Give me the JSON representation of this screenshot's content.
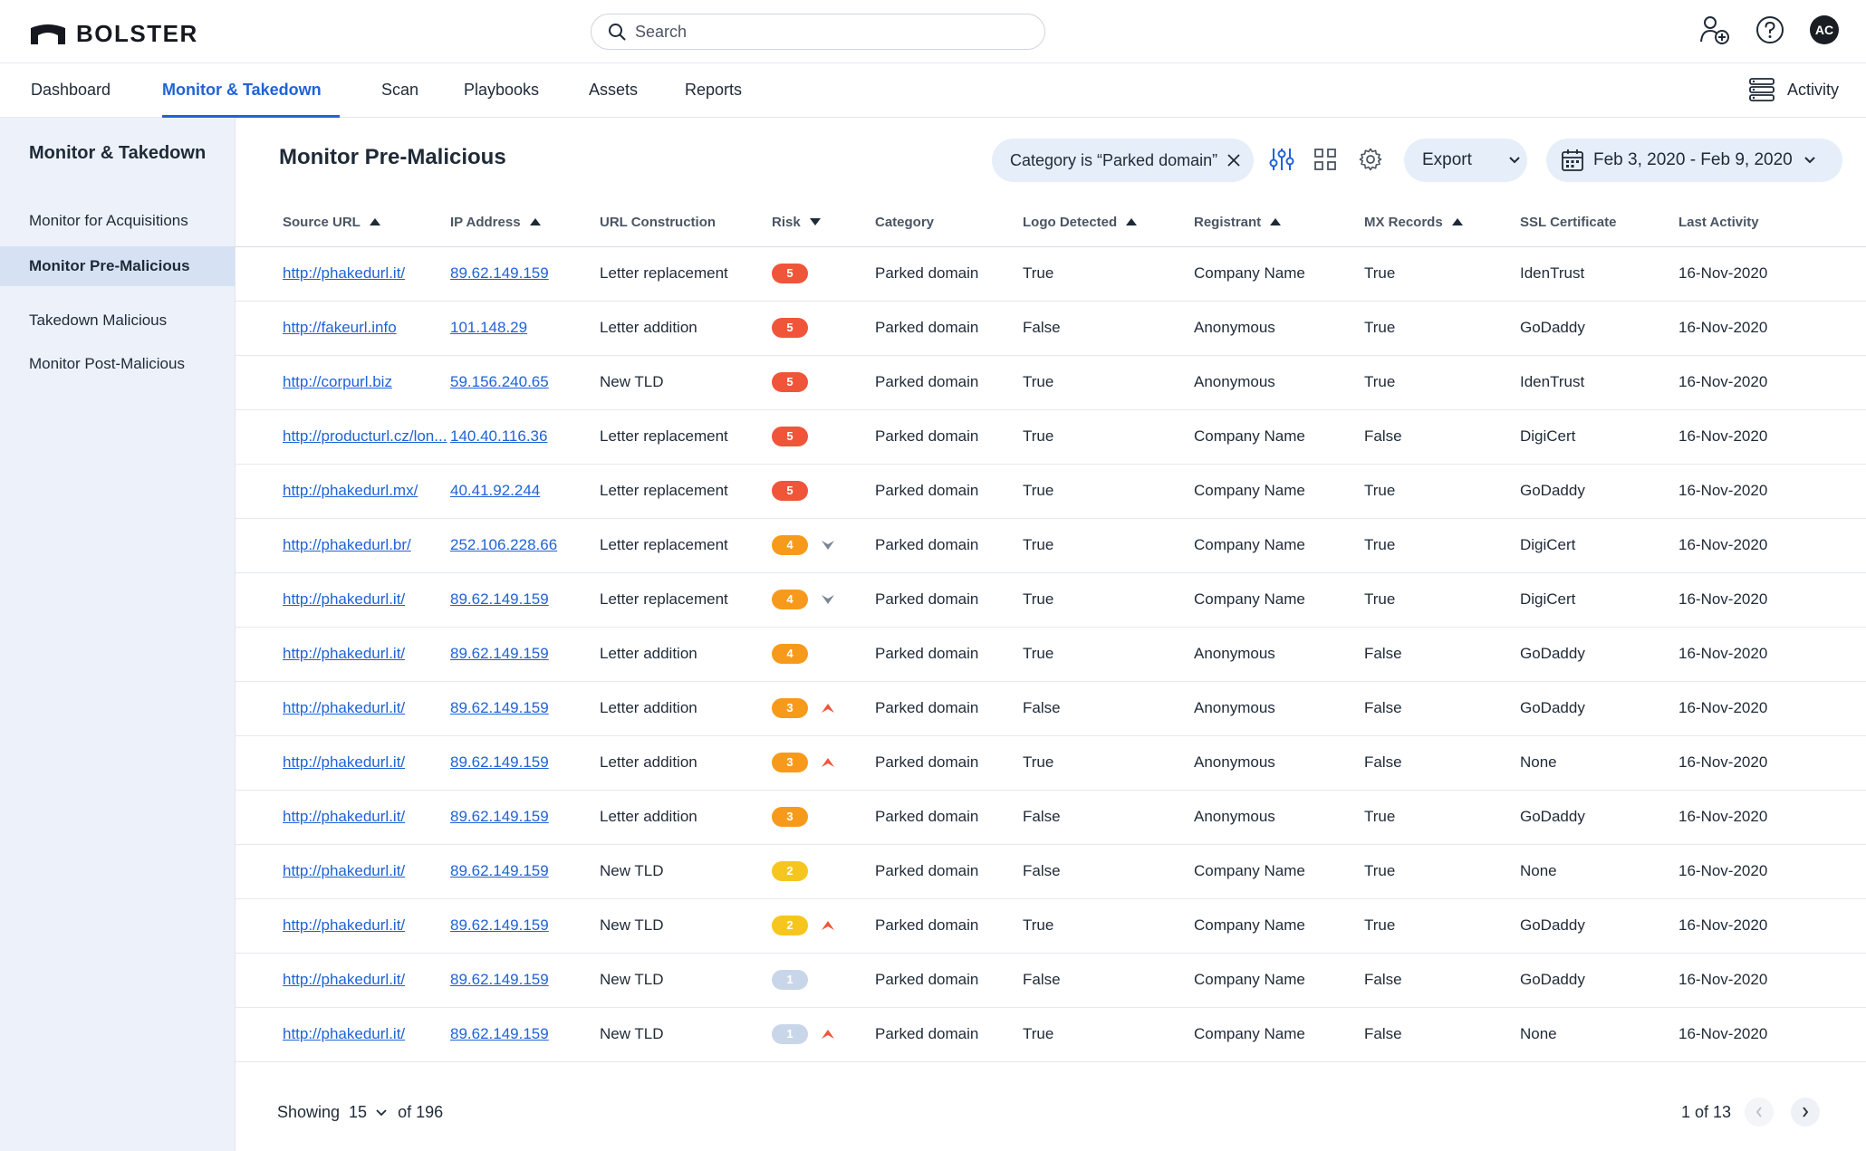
{
  "brand": {
    "name": "BOLSTER"
  },
  "search": {
    "placeholder": "Search"
  },
  "user": {
    "initials": "AC"
  },
  "nav": {
    "tabs": [
      "Dashboard",
      "Monitor & Takedown",
      "Scan",
      "Playbooks",
      "Assets",
      "Reports"
    ],
    "active_tab": "Monitor & Takedown",
    "activity_label": "Activity"
  },
  "sidebar": {
    "title": "Monitor & Takedown",
    "items": [
      "Monitor for Acquisitions",
      "Monitor Pre-Malicious",
      "Takedown Malicious",
      "Monitor Post-Malicious"
    ],
    "active_item": "Monitor Pre-Malicious"
  },
  "page": {
    "title": "Monitor Pre-Malicious",
    "filter_chip": "Category is “Parked domain”",
    "export_label": "Export",
    "date_range": "Feb 3, 2020 - Feb 9, 2020"
  },
  "table": {
    "columns": [
      "Source URL",
      "IP Address",
      "URL Construction",
      "Risk",
      "Category",
      "Logo Detected",
      "Registrant",
      "MX Records",
      "SSL Certificate",
      "Last Activity"
    ],
    "risk_colors": {
      "5": "#f0553a",
      "4": "#f79a1c",
      "3": "#f79a1c",
      "2": "#f7c61e",
      "1": "#c9d6ea"
    },
    "trend_colors": {
      "up": "#f0553a",
      "down": "#7b8794"
    },
    "rows": [
      {
        "url": "http://phakedurl.it/",
        "ip": "89.62.149.159",
        "construction": "Letter replacement",
        "risk": 5,
        "trend": "",
        "category": "Parked domain",
        "logo": "True",
        "registrant": "Company Name",
        "mx": "True",
        "ssl": "IdenTrust",
        "last": "16-Nov-2020"
      },
      {
        "url": "http://fakeurl.info",
        "ip": "101.148.29",
        "construction": "Letter addition",
        "risk": 5,
        "trend": "",
        "category": "Parked domain",
        "logo": "False",
        "registrant": "Anonymous",
        "mx": "True",
        "ssl": "GoDaddy",
        "last": "16-Nov-2020"
      },
      {
        "url": "http://corpurl.biz",
        "ip": "59.156.240.65",
        "construction": "New TLD",
        "risk": 5,
        "trend": "",
        "category": "Parked domain",
        "logo": "True",
        "registrant": "Anonymous",
        "mx": "True",
        "ssl": "IdenTrust",
        "last": "16-Nov-2020"
      },
      {
        "url": "http://producturl.cz/lon...",
        "ip": "140.40.116.36",
        "construction": "Letter replacement",
        "risk": 5,
        "trend": "",
        "category": "Parked domain",
        "logo": "True",
        "registrant": "Company Name",
        "mx": "False",
        "ssl": "DigiCert",
        "last": "16-Nov-2020"
      },
      {
        "url": "http://phakedurl.mx/",
        "ip": "40.41.92.244",
        "construction": "Letter replacement",
        "risk": 5,
        "trend": "",
        "category": "Parked domain",
        "logo": "True",
        "registrant": "Company Name",
        "mx": "True",
        "ssl": "GoDaddy",
        "last": "16-Nov-2020"
      },
      {
        "url": "http://phakedurl.br/",
        "ip": "252.106.228.66",
        "construction": "Letter replacement",
        "risk": 4,
        "trend": "down",
        "category": "Parked domain",
        "logo": "True",
        "registrant": "Company Name",
        "mx": "True",
        "ssl": "DigiCert",
        "last": "16-Nov-2020"
      },
      {
        "url": "http://phakedurl.it/",
        "ip": "89.62.149.159",
        "construction": "Letter replacement",
        "risk": 4,
        "trend": "down",
        "category": "Parked domain",
        "logo": "True",
        "registrant": "Company Name",
        "mx": "True",
        "ssl": "DigiCert",
        "last": "16-Nov-2020"
      },
      {
        "url": "http://phakedurl.it/",
        "ip": "89.62.149.159",
        "construction": "Letter addition",
        "risk": 4,
        "trend": "",
        "category": "Parked domain",
        "logo": "True",
        "registrant": "Anonymous",
        "mx": "False",
        "ssl": "GoDaddy",
        "last": "16-Nov-2020"
      },
      {
        "url": "http://phakedurl.it/",
        "ip": "89.62.149.159",
        "construction": "Letter addition",
        "risk": 3,
        "trend": "up",
        "category": "Parked domain",
        "logo": "False",
        "registrant": "Anonymous",
        "mx": "False",
        "ssl": "GoDaddy",
        "last": "16-Nov-2020"
      },
      {
        "url": "http://phakedurl.it/",
        "ip": "89.62.149.159",
        "construction": "Letter addition",
        "risk": 3,
        "trend": "up",
        "category": "Parked domain",
        "logo": "True",
        "registrant": "Anonymous",
        "mx": "False",
        "ssl": "None",
        "last": "16-Nov-2020"
      },
      {
        "url": "http://phakedurl.it/",
        "ip": "89.62.149.159",
        "construction": "Letter addition",
        "risk": 3,
        "trend": "",
        "category": "Parked domain",
        "logo": "False",
        "registrant": "Anonymous",
        "mx": "True",
        "ssl": "GoDaddy",
        "last": "16-Nov-2020"
      },
      {
        "url": "http://phakedurl.it/",
        "ip": "89.62.149.159",
        "construction": "New TLD",
        "risk": 2,
        "trend": "",
        "category": "Parked domain",
        "logo": "False",
        "registrant": "Company Name",
        "mx": "True",
        "ssl": "None",
        "last": "16-Nov-2020"
      },
      {
        "url": "http://phakedurl.it/",
        "ip": "89.62.149.159",
        "construction": "New TLD",
        "risk": 2,
        "trend": "up",
        "category": "Parked domain",
        "logo": "True",
        "registrant": "Company Name",
        "mx": "True",
        "ssl": "GoDaddy",
        "last": "16-Nov-2020"
      },
      {
        "url": "http://phakedurl.it/",
        "ip": "89.62.149.159",
        "construction": "New TLD",
        "risk": 1,
        "trend": "",
        "category": "Parked domain",
        "logo": "False",
        "registrant": "Company Name",
        "mx": "False",
        "ssl": "GoDaddy",
        "last": "16-Nov-2020"
      },
      {
        "url": "http://phakedurl.it/",
        "ip": "89.62.149.159",
        "construction": "New TLD",
        "risk": 1,
        "trend": "up",
        "category": "Parked domain",
        "logo": "True",
        "registrant": "Company Name",
        "mx": "False",
        "ssl": "None",
        "last": "16-Nov-2020"
      }
    ]
  },
  "footer": {
    "showing_label": "Showing",
    "page_size": "15",
    "of_total": "of 196",
    "page_info": "1 of 13"
  }
}
